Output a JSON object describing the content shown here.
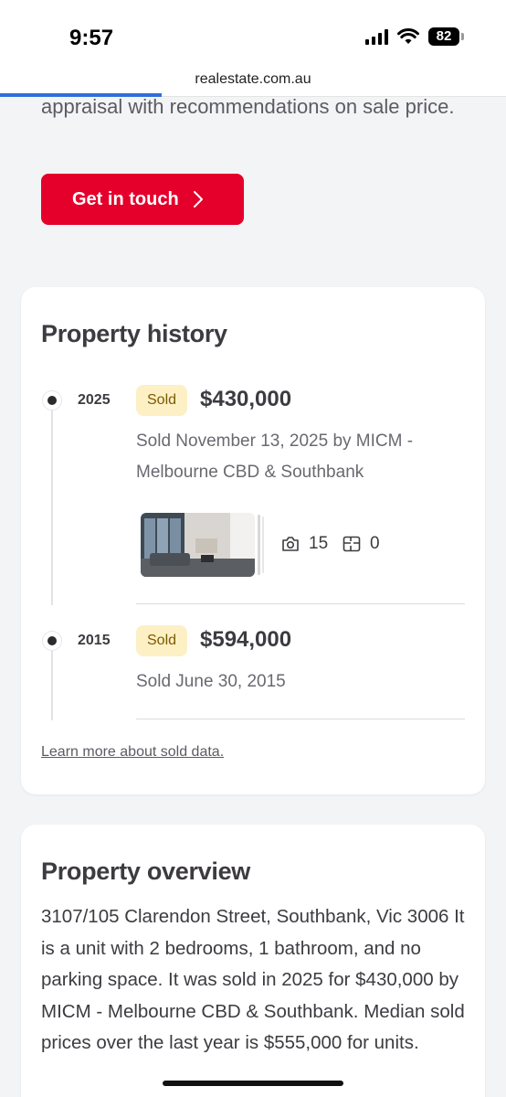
{
  "status_bar": {
    "time": "9:57",
    "battery": "82"
  },
  "browser": {
    "url": "realestate.com.au",
    "load_progress": 0.32
  },
  "intro": {
    "text": "appraisal with recommendations on sale price.",
    "cta_label": "Get in touch"
  },
  "property_history": {
    "title": "Property history",
    "entries": [
      {
        "year": "2025",
        "badge": "Sold",
        "price": "$430,000",
        "description": "Sold November 13, 2025 by MICM - Melbourne CBD & Southbank",
        "photo_count": "15",
        "floorplan_count": "0"
      },
      {
        "year": "2015",
        "badge": "Sold",
        "price": "$594,000",
        "description": "Sold June 30, 2015"
      }
    ],
    "learn_more": "Learn more about sold data."
  },
  "property_overview": {
    "title": "Property overview",
    "text": "3107/105 Clarendon Street, Southbank, Vic 3006 It is a unit with 2 bedrooms, 1 bathroom, and no parking space. It was sold in 2025 for $430,000 by MICM - Melbourne CBD & Southbank. Median sold prices over the last year is $555,000 for units."
  },
  "colors": {
    "accent": "#e4002b",
    "badge_bg": "#fdf0c5",
    "progress": "#2f6fdb"
  }
}
